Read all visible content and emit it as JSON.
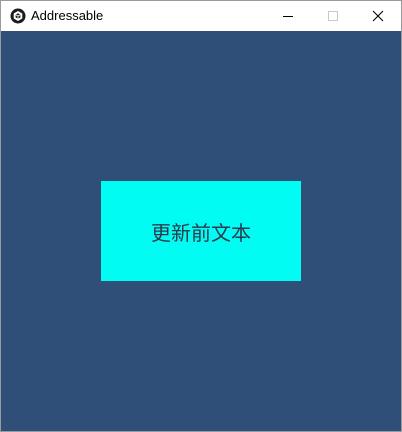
{
  "window": {
    "title": "Addressable",
    "controls": {
      "minimize": "minimize-icon",
      "maximize": "maximize-icon",
      "close": "close-icon"
    }
  },
  "client": {
    "background_color": "#304f78",
    "panel": {
      "text": "更新前文本",
      "background_color": "#00fcf3",
      "text_color": "#2a3a4c"
    }
  }
}
